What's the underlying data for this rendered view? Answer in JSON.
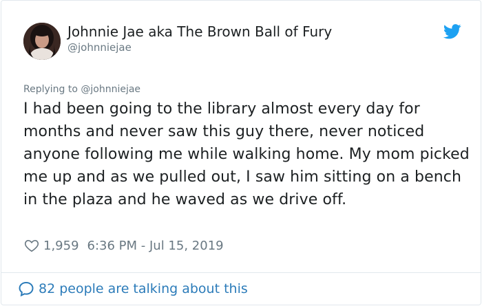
{
  "tweet": {
    "author_name": "Johnnie Jae aka The Brown Ball of Fury",
    "author_handle": "@johnniejae",
    "replying_prefix": "Replying to ",
    "replying_handle": "@johnniejae",
    "text": "I had been going to the library almost every day for months and never saw this guy there, never noticed anyone following me while walking home. My mom picked me up and as we pulled out, I saw him sitting on a bench in the plaza and he waved as we drive off.",
    "likes": "1,959",
    "timestamp": "6:36 PM - Jul 15, 2019",
    "talking": "82 people are talking about this"
  },
  "icons": {
    "brand": "twitter-bird-icon",
    "like": "heart-icon",
    "conversation": "speech-bubble-icon"
  },
  "colors": {
    "twitter_blue": "#1da1f2",
    "link_blue": "#2b7bb9",
    "muted": "#697882",
    "text": "#1c2022"
  }
}
